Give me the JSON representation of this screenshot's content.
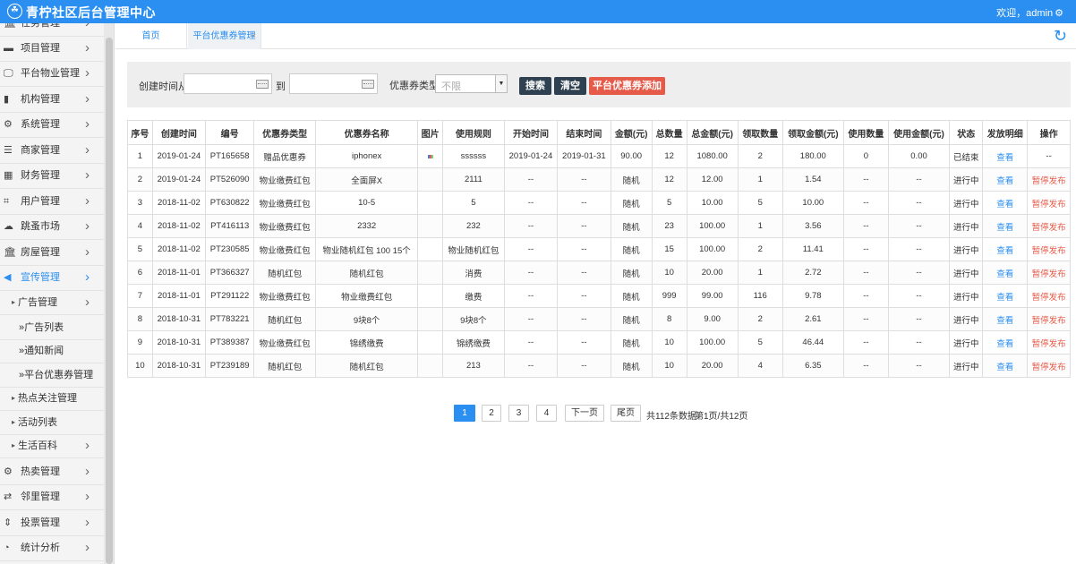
{
  "header": {
    "title": "青柠社区后台管理中心",
    "welcome": "欢迎，admin",
    "settings_icon": "gear-icon"
  },
  "sidebar": {
    "items": [
      {
        "label": "任务管理",
        "icon": "bank-icon"
      },
      {
        "label": "项目管理",
        "icon": "card-icon"
      },
      {
        "label": "平台物业管理",
        "icon": "monitor-icon"
      },
      {
        "label": "机构管理",
        "icon": "stripe-icon"
      },
      {
        "label": "系统管理",
        "icon": "gear-icon"
      },
      {
        "label": "商家管理",
        "icon": "list-icon"
      },
      {
        "label": "财务管理",
        "icon": "calculator-icon"
      },
      {
        "label": "用户管理",
        "icon": "crop-icon"
      },
      {
        "label": "跳蚤市场",
        "icon": "cloud-icon"
      },
      {
        "label": "房屋管理",
        "icon": "bank-icon"
      },
      {
        "label": "宣传管理",
        "icon": "volume-icon"
      }
    ],
    "sub_ad": "广告管理",
    "subsub": [
      "广告列表",
      "通知新闻",
      "平台优惠券管理"
    ],
    "sub_hot": "热点关注管理",
    "sub_activity": "活动列表",
    "sub_life": "生活百科",
    "bottom_items": [
      {
        "label": "热卖管理",
        "icon": "gear-icon"
      },
      {
        "label": "邻里管理",
        "icon": "retweet-icon"
      },
      {
        "label": "投票管理",
        "icon": "sort-icon"
      },
      {
        "label": "统计分析",
        "icon": "pie-icon"
      }
    ]
  },
  "tabs": {
    "home": "首页",
    "coupon": "平台优惠券管理",
    "close": "×"
  },
  "search": {
    "created_from": "创建时间从",
    "to": "到",
    "type_label": "优惠券类型",
    "type_value": "不限",
    "search_btn": "搜索",
    "clear_btn": "清空",
    "add_btn": "平台优惠券添加"
  },
  "table": {
    "headers": [
      "序号",
      "创建时间",
      "编号",
      "优惠券类型",
      "优惠券名称",
      "图片",
      "使用规则",
      "开始时间",
      "结束时间",
      "金额(元)",
      "总数量",
      "总金额(元)",
      "领取数量",
      "领取金额(元)",
      "使用数量",
      "使用金额(元)",
      "状态",
      "发放明细",
      "操作"
    ],
    "rows": [
      [
        "1",
        "2019-01-24",
        "PT165658",
        "赠品优惠券",
        "iphonex",
        "",
        "ssssss",
        "2019-01-24",
        "2019-01-31",
        "90.00",
        "12",
        "1080.00",
        "2",
        "180.00",
        "0",
        "0.00",
        "已结束",
        "查看",
        "--"
      ],
      [
        "2",
        "2019-01-24",
        "PT526090",
        "物业缴费红包",
        "全面屏X",
        "",
        "2111",
        "--",
        "--",
        "随机",
        "12",
        "12.00",
        "1",
        "1.54",
        "--",
        "--",
        "进行中",
        "查看",
        "暂停发布"
      ],
      [
        "3",
        "2018-11-02",
        "PT630822",
        "物业缴费红包",
        "10-5",
        "",
        "5",
        "--",
        "--",
        "随机",
        "5",
        "10.00",
        "5",
        "10.00",
        "--",
        "--",
        "进行中",
        "查看",
        "暂停发布"
      ],
      [
        "4",
        "2018-11-02",
        "PT416113",
        "物业缴费红包",
        "2332",
        "",
        "232",
        "--",
        "--",
        "随机",
        "23",
        "100.00",
        "1",
        "3.56",
        "--",
        "--",
        "进行中",
        "查看",
        "暂停发布"
      ],
      [
        "5",
        "2018-11-02",
        "PT230585",
        "物业缴费红包",
        "物业随机红包 100 15个",
        "",
        "物业随机红包",
        "--",
        "--",
        "随机",
        "15",
        "100.00",
        "2",
        "11.41",
        "--",
        "--",
        "进行中",
        "查看",
        "暂停发布"
      ],
      [
        "6",
        "2018-11-01",
        "PT366327",
        "随机红包",
        "随机红包",
        "",
        "消费",
        "--",
        "--",
        "随机",
        "10",
        "20.00",
        "1",
        "2.72",
        "--",
        "--",
        "进行中",
        "查看",
        "暂停发布"
      ],
      [
        "7",
        "2018-11-01",
        "PT291122",
        "物业缴费红包",
        "物业缴费红包",
        "",
        "缴费",
        "--",
        "--",
        "随机",
        "999",
        "99.00",
        "116",
        "9.78",
        "--",
        "--",
        "进行中",
        "查看",
        "暂停发布"
      ],
      [
        "8",
        "2018-10-31",
        "PT783221",
        "随机红包",
        "9块8个",
        "",
        "9块8个",
        "--",
        "--",
        "随机",
        "8",
        "9.00",
        "2",
        "2.61",
        "--",
        "--",
        "进行中",
        "查看",
        "暂停发布"
      ],
      [
        "9",
        "2018-10-31",
        "PT389387",
        "物业缴费红包",
        "锦绣缴费",
        "",
        "锦绣缴费",
        "--",
        "--",
        "随机",
        "10",
        "100.00",
        "5",
        "46.44",
        "--",
        "--",
        "进行中",
        "查看",
        "暂停发布"
      ],
      [
        "10",
        "2018-10-31",
        "PT239189",
        "随机红包",
        "随机红包",
        "",
        "213",
        "--",
        "--",
        "随机",
        "10",
        "20.00",
        "4",
        "6.35",
        "--",
        "--",
        "进行中",
        "查看",
        "暂停发布"
      ]
    ]
  },
  "pagination": {
    "pages": [
      "1",
      "2",
      "3",
      "4"
    ],
    "next": "下一页",
    "last": "尾页",
    "total": "共112条数据",
    "page_info": "第1页/共12页"
  },
  "colors": {
    "primary": "#2a8ff0",
    "dark_button": "#2f4050",
    "danger": "#e55a48"
  }
}
